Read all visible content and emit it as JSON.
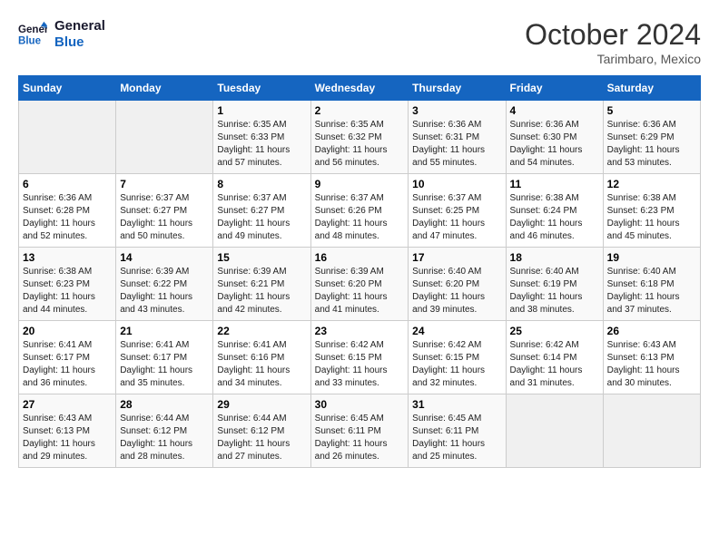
{
  "header": {
    "logo": {
      "line1": "General",
      "line2": "Blue"
    },
    "title": "October 2024",
    "location": "Tarimbaro, Mexico"
  },
  "days_of_week": [
    "Sunday",
    "Monday",
    "Tuesday",
    "Wednesday",
    "Thursday",
    "Friday",
    "Saturday"
  ],
  "weeks": [
    [
      {
        "day": "",
        "empty": true
      },
      {
        "day": "",
        "empty": true
      },
      {
        "day": "1",
        "sunrise": "Sunrise: 6:35 AM",
        "sunset": "Sunset: 6:33 PM",
        "daylight": "Daylight: 11 hours and 57 minutes."
      },
      {
        "day": "2",
        "sunrise": "Sunrise: 6:35 AM",
        "sunset": "Sunset: 6:32 PM",
        "daylight": "Daylight: 11 hours and 56 minutes."
      },
      {
        "day": "3",
        "sunrise": "Sunrise: 6:36 AM",
        "sunset": "Sunset: 6:31 PM",
        "daylight": "Daylight: 11 hours and 55 minutes."
      },
      {
        "day": "4",
        "sunrise": "Sunrise: 6:36 AM",
        "sunset": "Sunset: 6:30 PM",
        "daylight": "Daylight: 11 hours and 54 minutes."
      },
      {
        "day": "5",
        "sunrise": "Sunrise: 6:36 AM",
        "sunset": "Sunset: 6:29 PM",
        "daylight": "Daylight: 11 hours and 53 minutes."
      }
    ],
    [
      {
        "day": "6",
        "sunrise": "Sunrise: 6:36 AM",
        "sunset": "Sunset: 6:28 PM",
        "daylight": "Daylight: 11 hours and 52 minutes."
      },
      {
        "day": "7",
        "sunrise": "Sunrise: 6:37 AM",
        "sunset": "Sunset: 6:27 PM",
        "daylight": "Daylight: 11 hours and 50 minutes."
      },
      {
        "day": "8",
        "sunrise": "Sunrise: 6:37 AM",
        "sunset": "Sunset: 6:27 PM",
        "daylight": "Daylight: 11 hours and 49 minutes."
      },
      {
        "day": "9",
        "sunrise": "Sunrise: 6:37 AM",
        "sunset": "Sunset: 6:26 PM",
        "daylight": "Daylight: 11 hours and 48 minutes."
      },
      {
        "day": "10",
        "sunrise": "Sunrise: 6:37 AM",
        "sunset": "Sunset: 6:25 PM",
        "daylight": "Daylight: 11 hours and 47 minutes."
      },
      {
        "day": "11",
        "sunrise": "Sunrise: 6:38 AM",
        "sunset": "Sunset: 6:24 PM",
        "daylight": "Daylight: 11 hours and 46 minutes."
      },
      {
        "day": "12",
        "sunrise": "Sunrise: 6:38 AM",
        "sunset": "Sunset: 6:23 PM",
        "daylight": "Daylight: 11 hours and 45 minutes."
      }
    ],
    [
      {
        "day": "13",
        "sunrise": "Sunrise: 6:38 AM",
        "sunset": "Sunset: 6:23 PM",
        "daylight": "Daylight: 11 hours and 44 minutes."
      },
      {
        "day": "14",
        "sunrise": "Sunrise: 6:39 AM",
        "sunset": "Sunset: 6:22 PM",
        "daylight": "Daylight: 11 hours and 43 minutes."
      },
      {
        "day": "15",
        "sunrise": "Sunrise: 6:39 AM",
        "sunset": "Sunset: 6:21 PM",
        "daylight": "Daylight: 11 hours and 42 minutes."
      },
      {
        "day": "16",
        "sunrise": "Sunrise: 6:39 AM",
        "sunset": "Sunset: 6:20 PM",
        "daylight": "Daylight: 11 hours and 41 minutes."
      },
      {
        "day": "17",
        "sunrise": "Sunrise: 6:40 AM",
        "sunset": "Sunset: 6:20 PM",
        "daylight": "Daylight: 11 hours and 39 minutes."
      },
      {
        "day": "18",
        "sunrise": "Sunrise: 6:40 AM",
        "sunset": "Sunset: 6:19 PM",
        "daylight": "Daylight: 11 hours and 38 minutes."
      },
      {
        "day": "19",
        "sunrise": "Sunrise: 6:40 AM",
        "sunset": "Sunset: 6:18 PM",
        "daylight": "Daylight: 11 hours and 37 minutes."
      }
    ],
    [
      {
        "day": "20",
        "sunrise": "Sunrise: 6:41 AM",
        "sunset": "Sunset: 6:17 PM",
        "daylight": "Daylight: 11 hours and 36 minutes."
      },
      {
        "day": "21",
        "sunrise": "Sunrise: 6:41 AM",
        "sunset": "Sunset: 6:17 PM",
        "daylight": "Daylight: 11 hours and 35 minutes."
      },
      {
        "day": "22",
        "sunrise": "Sunrise: 6:41 AM",
        "sunset": "Sunset: 6:16 PM",
        "daylight": "Daylight: 11 hours and 34 minutes."
      },
      {
        "day": "23",
        "sunrise": "Sunrise: 6:42 AM",
        "sunset": "Sunset: 6:15 PM",
        "daylight": "Daylight: 11 hours and 33 minutes."
      },
      {
        "day": "24",
        "sunrise": "Sunrise: 6:42 AM",
        "sunset": "Sunset: 6:15 PM",
        "daylight": "Daylight: 11 hours and 32 minutes."
      },
      {
        "day": "25",
        "sunrise": "Sunrise: 6:42 AM",
        "sunset": "Sunset: 6:14 PM",
        "daylight": "Daylight: 11 hours and 31 minutes."
      },
      {
        "day": "26",
        "sunrise": "Sunrise: 6:43 AM",
        "sunset": "Sunset: 6:13 PM",
        "daylight": "Daylight: 11 hours and 30 minutes."
      }
    ],
    [
      {
        "day": "27",
        "sunrise": "Sunrise: 6:43 AM",
        "sunset": "Sunset: 6:13 PM",
        "daylight": "Daylight: 11 hours and 29 minutes."
      },
      {
        "day": "28",
        "sunrise": "Sunrise: 6:44 AM",
        "sunset": "Sunset: 6:12 PM",
        "daylight": "Daylight: 11 hours and 28 minutes."
      },
      {
        "day": "29",
        "sunrise": "Sunrise: 6:44 AM",
        "sunset": "Sunset: 6:12 PM",
        "daylight": "Daylight: 11 hours and 27 minutes."
      },
      {
        "day": "30",
        "sunrise": "Sunrise: 6:45 AM",
        "sunset": "Sunset: 6:11 PM",
        "daylight": "Daylight: 11 hours and 26 minutes."
      },
      {
        "day": "31",
        "sunrise": "Sunrise: 6:45 AM",
        "sunset": "Sunset: 6:11 PM",
        "daylight": "Daylight: 11 hours and 25 minutes."
      },
      {
        "day": "",
        "empty": true
      },
      {
        "day": "",
        "empty": true
      }
    ]
  ]
}
